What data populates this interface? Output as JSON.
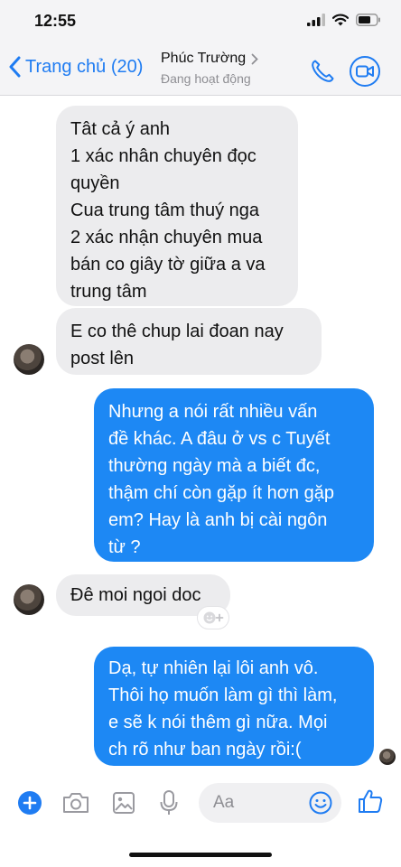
{
  "status": {
    "time": "12:55"
  },
  "header": {
    "back_label": "Trang chủ (20)",
    "contact_name": "Phúc Trường",
    "contact_status": "Đang hoạt động"
  },
  "messages": [
    {
      "side": "in",
      "text": "Tât cả ý anh\n1 xác nhân chuyên đọc\nquyền\nCua trung tâm thuý nga\n2 xác nhận chuyên mua\nbán co giây tờ giữa a va\ntrung tâm"
    },
    {
      "side": "in",
      "text": "E co thê chup lai đoan nay\npost lên"
    },
    {
      "side": "out",
      "text": "Nhưng a nói rất nhiều vấn\nđề khác. A đâu ở vs c Tuyết\nthường ngày mà a biết đc,\nthậm chí còn gặp ít hơn gặp\nem? Hay là anh bị cài ngôn\ntừ ?"
    },
    {
      "side": "in",
      "text": "Đê moi ngoi doc"
    },
    {
      "side": "out",
      "text": "Dạ, tự nhiên lại lôi anh vô.\nThôi họ muốn làm gì thì làm,\ne sẽ k nói thêm gì nữa. Mọi\nch rõ như ban ngày rồi:("
    }
  ],
  "composer": {
    "placeholder": "Aa"
  },
  "colors": {
    "accent": "#1f7cf2",
    "outgoing_bubble": "#1d88f4",
    "incoming_bubble": "#ececee"
  }
}
